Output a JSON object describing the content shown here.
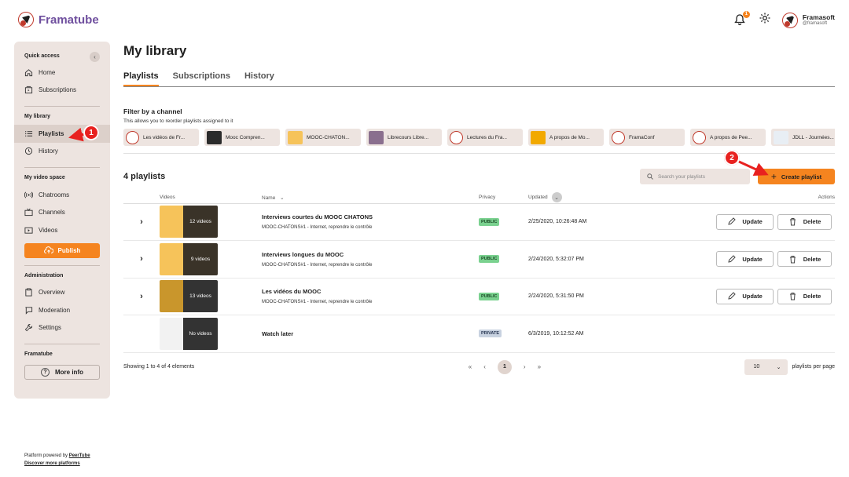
{
  "header": {
    "brand": "Framatube",
    "notif_count": "1",
    "user_name": "Framasoft",
    "user_handle": "@framasoft"
  },
  "sidebar": {
    "quick_access": "Quick access",
    "home": "Home",
    "subscriptions": "Subscriptions",
    "my_library": "My library",
    "playlists": "Playlists",
    "history": "History",
    "my_video_space": "My video space",
    "chatrooms": "Chatrooms",
    "channels": "Channels",
    "videos": "Videos",
    "publish": "Publish",
    "administration": "Administration",
    "overview": "Overview",
    "moderation": "Moderation",
    "settings": "Settings",
    "framatube": "Framatube",
    "more_info": "More info",
    "collapse": "‹"
  },
  "footer": {
    "powered": "Platform powered by",
    "peertube": "PeerTube",
    "discover": "Discover more platforms"
  },
  "main": {
    "title": "My library",
    "tabs": [
      "Playlists",
      "Subscriptions",
      "History"
    ],
    "filter_title": "Filter by a channel",
    "filter_sub": "This allows you to reorder playlists assigned to it",
    "channels": [
      {
        "label": "Les vidéos de Fr...",
        "color": "#ffffff"
      },
      {
        "label": "Mooc Compren...",
        "color": "#2b2b2b"
      },
      {
        "label": "MOOC-CHATON...",
        "color": "#f6c35a"
      },
      {
        "label": "Librecours Libre...",
        "color": "#8a6f8e"
      },
      {
        "label": "Lectures du Fra...",
        "color": "#ffffff"
      },
      {
        "label": "A propos de Mo...",
        "color": "#f2a900"
      },
      {
        "label": "FramaConf",
        "color": "#ffffff"
      },
      {
        "label": "A propos de Pee...",
        "color": "#ffffff"
      },
      {
        "label": "JDLL - Journées...",
        "color": "#e8eef4"
      }
    ],
    "count_label": "4 playlists",
    "search_placeholder": "Search your playlists",
    "create_label": "Create playlist",
    "columns": {
      "videos": "Videos",
      "name": "Name",
      "privacy": "Privacy",
      "updated": "Updated",
      "actions": "Actions"
    },
    "rows": [
      {
        "thumb": "12 videos",
        "name": "Interviews courtes du MOOC CHATONS",
        "owner": "MOOC-CHATONS#1 - Internet, reprendre le contrôle",
        "privacy": "PUBLIC",
        "updated": "2/25/2020, 10:26:48 AM"
      },
      {
        "thumb": "9 videos",
        "name": "Interviews longues du MOOC",
        "owner": "MOOC-CHATONS#1 - Internet, reprendre le contrôle",
        "privacy": "PUBLIC",
        "updated": "2/24/2020, 5:32:07 PM"
      },
      {
        "thumb": "13 videos",
        "name": "Les vidéos du MOOC",
        "owner": "MOOC-CHATONS#1 - Internet, reprendre le contrôle",
        "privacy": "PUBLIC",
        "updated": "2/24/2020, 5:31:50 PM"
      },
      {
        "thumb": "No videos",
        "name": "Watch later",
        "owner": "",
        "privacy": "PRIVATE",
        "updated": "6/3/2019, 10:12:52 AM"
      }
    ],
    "update_label": "Update",
    "delete_label": "Delete",
    "showing": "Showing 1 to 4 of 4 elements",
    "pager": {
      "first": "«",
      "prev": "‹",
      "current": "1",
      "next": "›",
      "last": "»"
    },
    "per_page_value": "10",
    "per_page_label": "playlists per page"
  },
  "annotations": {
    "one": "1",
    "two": "2"
  }
}
